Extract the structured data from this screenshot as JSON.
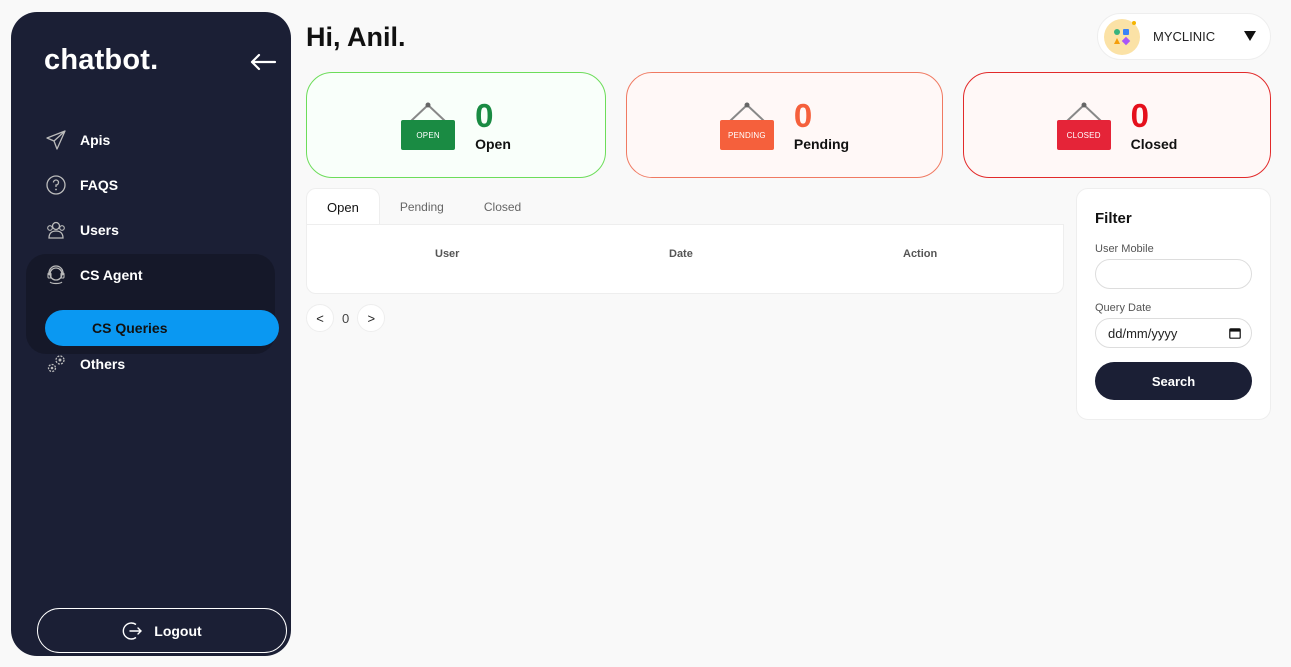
{
  "app": {
    "brand": "chatbot."
  },
  "sidebar": {
    "items": [
      {
        "label": "Apis",
        "icon": "paper-plane-icon"
      },
      {
        "label": "FAQS",
        "icon": "question-bubble-icon"
      },
      {
        "label": "Users",
        "icon": "users-icon"
      },
      {
        "label": "CS Agent",
        "icon": "headset-icon"
      },
      {
        "label": "Others",
        "icon": "gears-icon"
      }
    ],
    "active_sub": "CS Queries",
    "logout_label": "Logout"
  },
  "header": {
    "greeting": "Hi, Anil.",
    "clinic": "MYCLINIC"
  },
  "cards": [
    {
      "sign": "OPEN",
      "count": "0",
      "label": "Open",
      "color": "#1a8b43"
    },
    {
      "sign": "PENDING",
      "count": "0",
      "label": "Pending",
      "color": "#f5603c"
    },
    {
      "sign": "CLOSED",
      "count": "0",
      "label": "Closed",
      "color": "#e5101c"
    }
  ],
  "tabs": [
    "Open",
    "Pending",
    "Closed"
  ],
  "table": {
    "columns": [
      "User",
      "Date",
      "Action"
    ]
  },
  "pagination": {
    "prev": "<",
    "page": "0",
    "next": ">"
  },
  "filter": {
    "title": "Filter",
    "mobile_label": "User Mobile",
    "mobile_value": "",
    "date_label": "Query Date",
    "date_placeholder": "dd/mm/yyyy",
    "search_label": "Search"
  }
}
